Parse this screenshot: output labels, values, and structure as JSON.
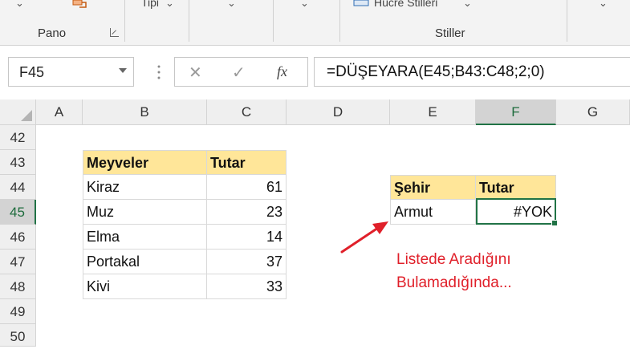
{
  "ribbon": {
    "font_group_label": "Pano",
    "styles_group_label": "Stiller",
    "number_format_partial": "Tipi",
    "cell_styles_partial": "Hücre Stilleri"
  },
  "formula_bar": {
    "name_box": "F45",
    "cancel_glyph": "✕",
    "enter_glyph": "✓",
    "fx_label": "fx",
    "formula": "=DÜŞEYARA(E45;B43:C48;2;0)"
  },
  "grid": {
    "columns": [
      "A",
      "B",
      "C",
      "D",
      "E",
      "F",
      "G"
    ],
    "selected_column": "F",
    "rows": [
      "42",
      "43",
      "44",
      "45",
      "46",
      "47",
      "48",
      "49",
      "50"
    ],
    "selected_row": "45"
  },
  "source_table": {
    "headers": [
      "Meyveler",
      "Tutar"
    ],
    "rows": [
      [
        "Kiraz",
        "61"
      ],
      [
        "Muz",
        "23"
      ],
      [
        "Elma",
        "14"
      ],
      [
        "Portakal",
        "37"
      ],
      [
        "Kivi",
        "33"
      ]
    ]
  },
  "lookup_table": {
    "headers": [
      "Şehir",
      "Tutar"
    ],
    "lookup_value": "Armut",
    "result": "#YOK"
  },
  "annotation": {
    "line1": "Listede Aradığını",
    "line2": "Bulamadığında...",
    "color": "#e0202a"
  },
  "colors": {
    "header_fill": "#ffe699",
    "selection": "#217346"
  }
}
